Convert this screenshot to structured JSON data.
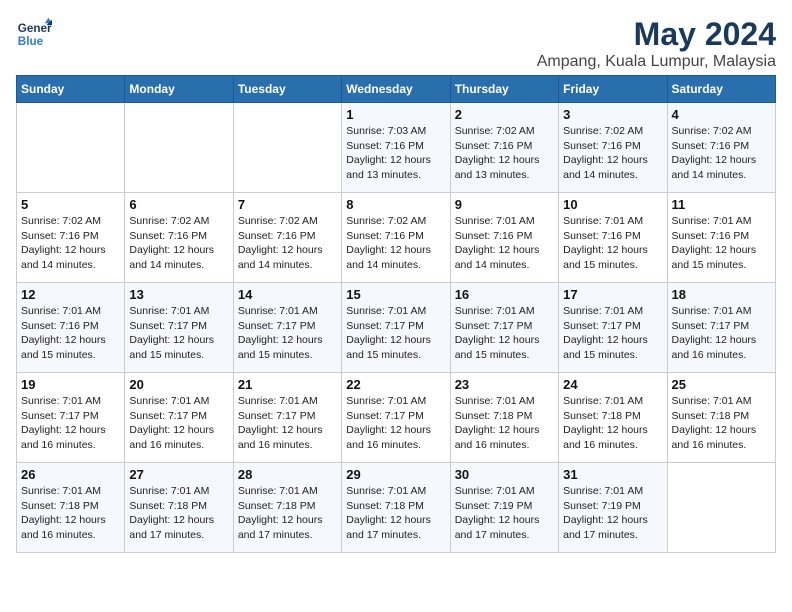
{
  "logo": {
    "line1": "General",
    "line2": "Blue"
  },
  "title": "May 2024",
  "subtitle": "Ampang, Kuala Lumpur, Malaysia",
  "days_header": [
    "Sunday",
    "Monday",
    "Tuesday",
    "Wednesday",
    "Thursday",
    "Friday",
    "Saturday"
  ],
  "weeks": [
    [
      {
        "day": "",
        "info": ""
      },
      {
        "day": "",
        "info": ""
      },
      {
        "day": "",
        "info": ""
      },
      {
        "day": "1",
        "info": "Sunrise: 7:03 AM\nSunset: 7:16 PM\nDaylight: 12 hours\nand 13 minutes."
      },
      {
        "day": "2",
        "info": "Sunrise: 7:02 AM\nSunset: 7:16 PM\nDaylight: 12 hours\nand 13 minutes."
      },
      {
        "day": "3",
        "info": "Sunrise: 7:02 AM\nSunset: 7:16 PM\nDaylight: 12 hours\nand 14 minutes."
      },
      {
        "day": "4",
        "info": "Sunrise: 7:02 AM\nSunset: 7:16 PM\nDaylight: 12 hours\nand 14 minutes."
      }
    ],
    [
      {
        "day": "5",
        "info": "Sunrise: 7:02 AM\nSunset: 7:16 PM\nDaylight: 12 hours\nand 14 minutes."
      },
      {
        "day": "6",
        "info": "Sunrise: 7:02 AM\nSunset: 7:16 PM\nDaylight: 12 hours\nand 14 minutes."
      },
      {
        "day": "7",
        "info": "Sunrise: 7:02 AM\nSunset: 7:16 PM\nDaylight: 12 hours\nand 14 minutes."
      },
      {
        "day": "8",
        "info": "Sunrise: 7:02 AM\nSunset: 7:16 PM\nDaylight: 12 hours\nand 14 minutes."
      },
      {
        "day": "9",
        "info": "Sunrise: 7:01 AM\nSunset: 7:16 PM\nDaylight: 12 hours\nand 14 minutes."
      },
      {
        "day": "10",
        "info": "Sunrise: 7:01 AM\nSunset: 7:16 PM\nDaylight: 12 hours\nand 15 minutes."
      },
      {
        "day": "11",
        "info": "Sunrise: 7:01 AM\nSunset: 7:16 PM\nDaylight: 12 hours\nand 15 minutes."
      }
    ],
    [
      {
        "day": "12",
        "info": "Sunrise: 7:01 AM\nSunset: 7:16 PM\nDaylight: 12 hours\nand 15 minutes."
      },
      {
        "day": "13",
        "info": "Sunrise: 7:01 AM\nSunset: 7:17 PM\nDaylight: 12 hours\nand 15 minutes."
      },
      {
        "day": "14",
        "info": "Sunrise: 7:01 AM\nSunset: 7:17 PM\nDaylight: 12 hours\nand 15 minutes."
      },
      {
        "day": "15",
        "info": "Sunrise: 7:01 AM\nSunset: 7:17 PM\nDaylight: 12 hours\nand 15 minutes."
      },
      {
        "day": "16",
        "info": "Sunrise: 7:01 AM\nSunset: 7:17 PM\nDaylight: 12 hours\nand 15 minutes."
      },
      {
        "day": "17",
        "info": "Sunrise: 7:01 AM\nSunset: 7:17 PM\nDaylight: 12 hours\nand 15 minutes."
      },
      {
        "day": "18",
        "info": "Sunrise: 7:01 AM\nSunset: 7:17 PM\nDaylight: 12 hours\nand 16 minutes."
      }
    ],
    [
      {
        "day": "19",
        "info": "Sunrise: 7:01 AM\nSunset: 7:17 PM\nDaylight: 12 hours\nand 16 minutes."
      },
      {
        "day": "20",
        "info": "Sunrise: 7:01 AM\nSunset: 7:17 PM\nDaylight: 12 hours\nand 16 minutes."
      },
      {
        "day": "21",
        "info": "Sunrise: 7:01 AM\nSunset: 7:17 PM\nDaylight: 12 hours\nand 16 minutes."
      },
      {
        "day": "22",
        "info": "Sunrise: 7:01 AM\nSunset: 7:17 PM\nDaylight: 12 hours\nand 16 minutes."
      },
      {
        "day": "23",
        "info": "Sunrise: 7:01 AM\nSunset: 7:18 PM\nDaylight: 12 hours\nand 16 minutes."
      },
      {
        "day": "24",
        "info": "Sunrise: 7:01 AM\nSunset: 7:18 PM\nDaylight: 12 hours\nand 16 minutes."
      },
      {
        "day": "25",
        "info": "Sunrise: 7:01 AM\nSunset: 7:18 PM\nDaylight: 12 hours\nand 16 minutes."
      }
    ],
    [
      {
        "day": "26",
        "info": "Sunrise: 7:01 AM\nSunset: 7:18 PM\nDaylight: 12 hours\nand 16 minutes."
      },
      {
        "day": "27",
        "info": "Sunrise: 7:01 AM\nSunset: 7:18 PM\nDaylight: 12 hours\nand 17 minutes."
      },
      {
        "day": "28",
        "info": "Sunrise: 7:01 AM\nSunset: 7:18 PM\nDaylight: 12 hours\nand 17 minutes."
      },
      {
        "day": "29",
        "info": "Sunrise: 7:01 AM\nSunset: 7:18 PM\nDaylight: 12 hours\nand 17 minutes."
      },
      {
        "day": "30",
        "info": "Sunrise: 7:01 AM\nSunset: 7:19 PM\nDaylight: 12 hours\nand 17 minutes."
      },
      {
        "day": "31",
        "info": "Sunrise: 7:01 AM\nSunset: 7:19 PM\nDaylight: 12 hours\nand 17 minutes."
      },
      {
        "day": "",
        "info": ""
      }
    ]
  ]
}
